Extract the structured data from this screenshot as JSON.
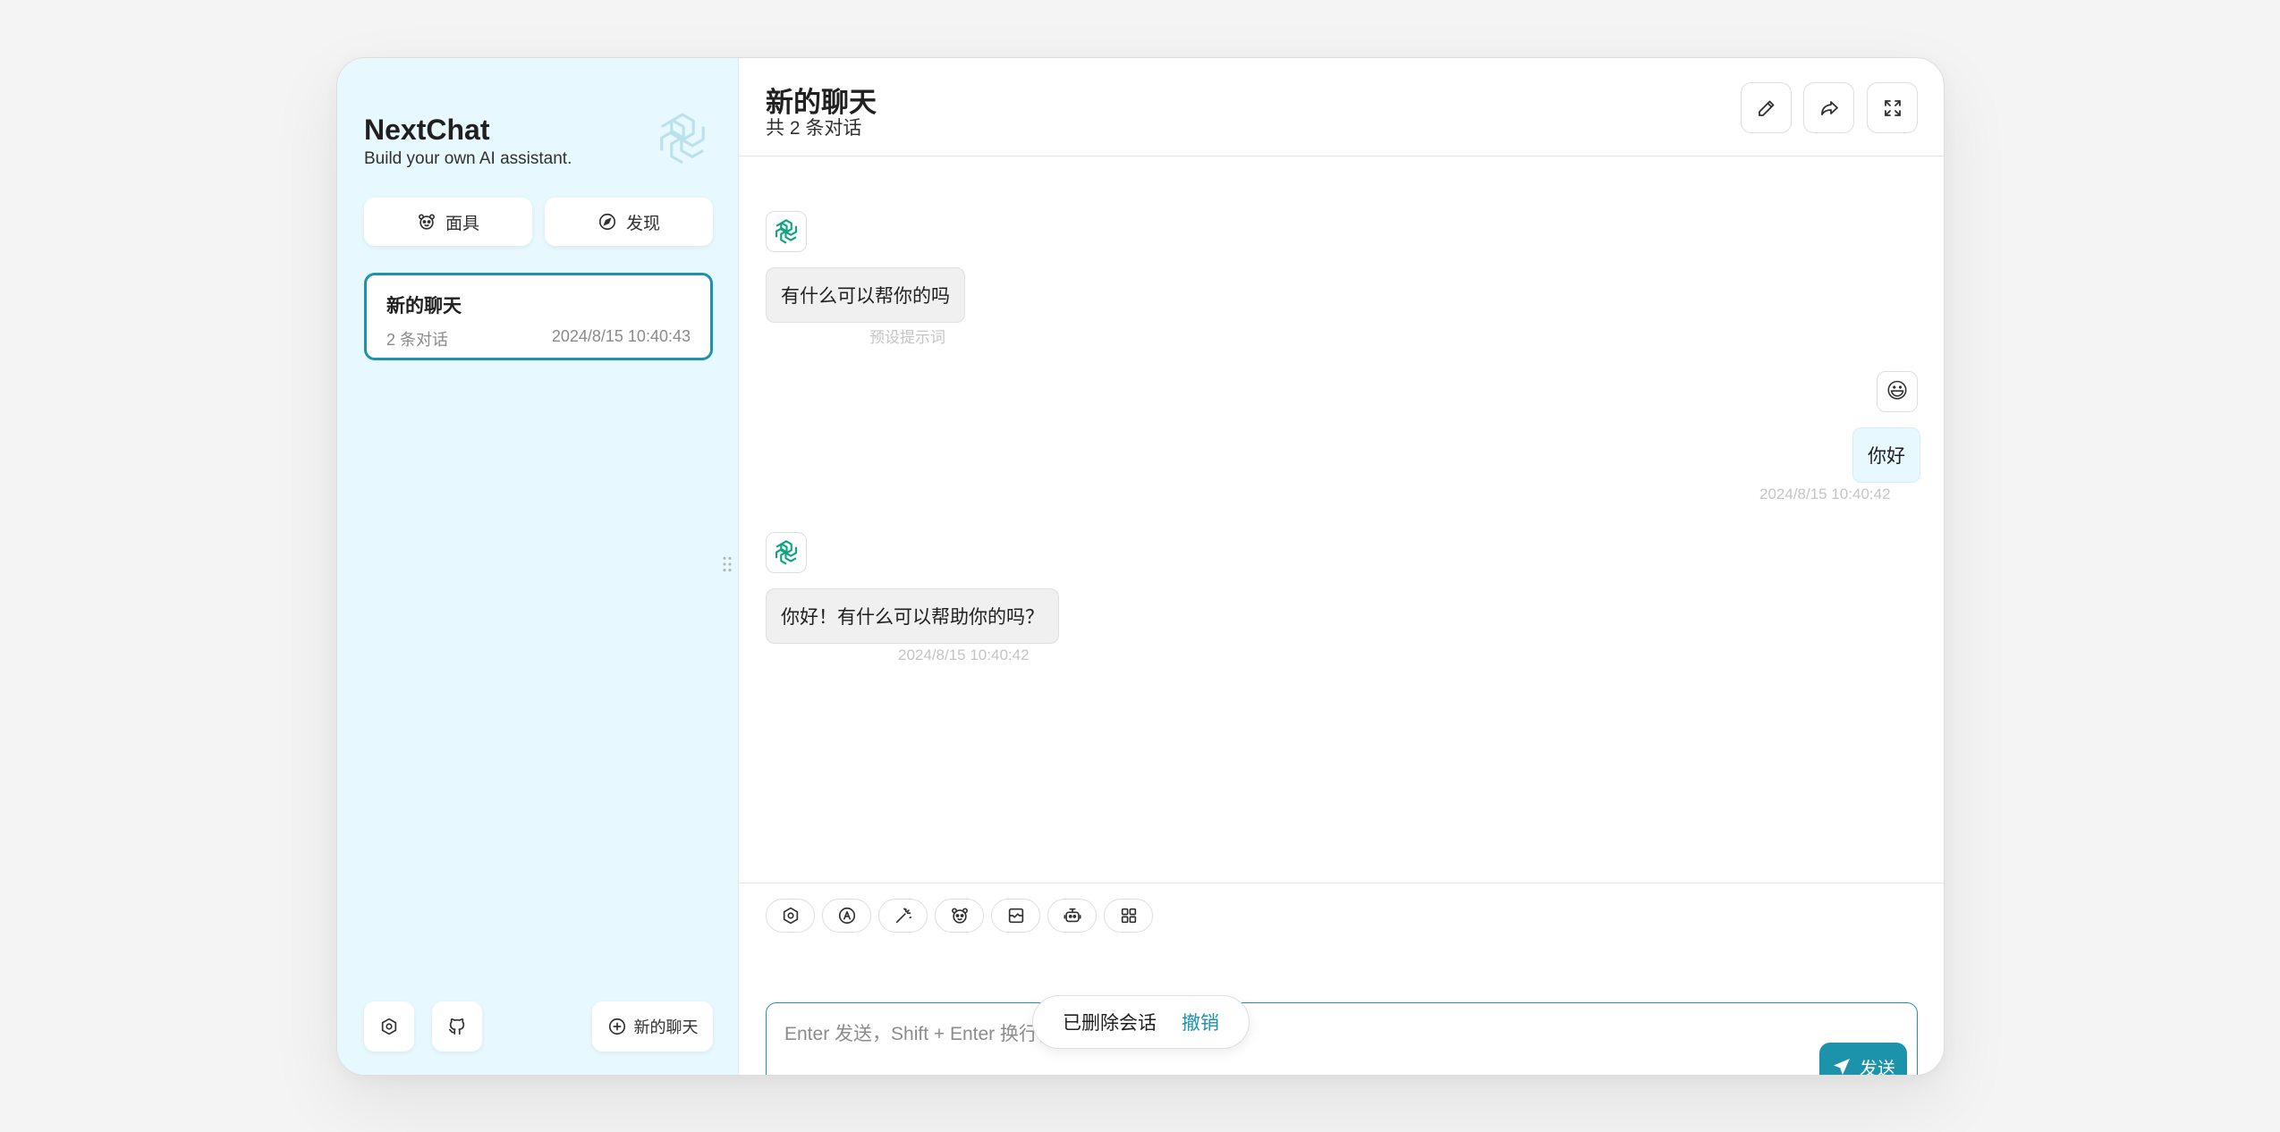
{
  "sidebar": {
    "brand_title": "NextChat",
    "brand_subtitle": "Build your own AI assistant.",
    "mask_label": "面具",
    "discover_label": "发现",
    "chats": [
      {
        "title": "新的聊天",
        "count": "2 条对话",
        "date": "2024/8/15 10:40:43"
      }
    ],
    "new_chat_label": "新的聊天"
  },
  "header": {
    "title": "新的聊天",
    "subtitle": "共 2 条对话"
  },
  "messages": [
    {
      "role": "assistant",
      "text": "有什么可以帮你的吗",
      "meta": "预设提示词"
    },
    {
      "role": "user",
      "avatar": "😃",
      "text": "你好",
      "meta": "2024/8/15 10:40:42"
    },
    {
      "role": "assistant",
      "text": "你好！有什么可以帮助你的吗？",
      "meta": "2024/8/15 10:40:42"
    }
  ],
  "input": {
    "placeholder": "Enter 发送，Shift + Enter 换行，/ 触发补全，: 触发命令",
    "send_label": "发送"
  },
  "toast": {
    "message": "已删除会话",
    "action": "撤销"
  },
  "colors": {
    "accent": "#1d93ab",
    "sidebar_bg": "#e7f8ff",
    "openai_green": "#10a37f"
  }
}
